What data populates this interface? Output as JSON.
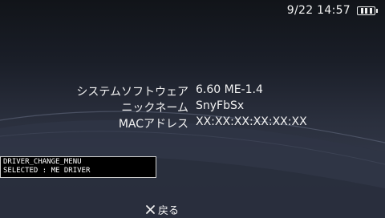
{
  "status": {
    "date_time": "9/22 14:57",
    "battery_icon": "battery-full-icon"
  },
  "system_info": {
    "rows": [
      {
        "label": "システムソフトウェア",
        "value": "6.60 ME-1.4"
      },
      {
        "label": "ニックネーム",
        "value": "SnyFbSx"
      },
      {
        "label": "MACアドレス",
        "value": "XX:XX:XX:XX:XX:XX"
      }
    ]
  },
  "debug_overlay": {
    "line1": "DRIVER_CHANGE_MENU",
    "line2": "SELECTED : ME DRIVER"
  },
  "footer": {
    "back_label": "戻る",
    "back_icon": "cross-button-icon"
  }
}
